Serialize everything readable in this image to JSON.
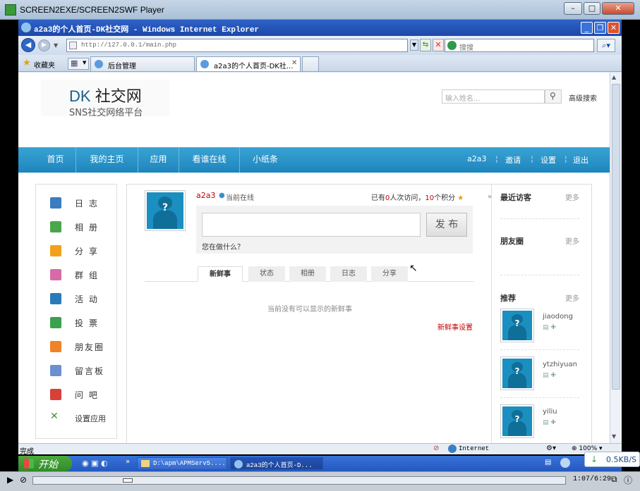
{
  "player": {
    "title": "SCREEN2EXE/SCREEN2SWF Player",
    "time": "1:07/6:29",
    "progress": 0.172
  },
  "browser": {
    "title": "a2a3的个人首页-DK社交网 - Windows Internet Explorer",
    "url": "http://127.0.0.1/main.php",
    "search_placeholder": "搜搜",
    "favorites": "收藏夹",
    "tabs": [
      "后台管理",
      "a2a3的个人首页-DK社..."
    ],
    "status": "完成",
    "zone": "Internet",
    "zoom": "100%"
  },
  "site": {
    "logo": "DK",
    "logo_cn": "社交网",
    "tagline": "SNS社交网络平台",
    "search_placeholder": "输入姓名...",
    "advanced_search": "高级搜索",
    "nav": [
      "首页",
      "我的主页",
      "应用",
      "看谁在线",
      "小纸条"
    ],
    "nav_right": [
      "a2a3",
      "邀请",
      "设置",
      "退出"
    ],
    "menu": [
      "日志",
      "相册",
      "分享",
      "群组",
      "活动",
      "投票",
      "朋友圈",
      "留言板",
      "问吧",
      "设置应用"
    ],
    "user": "a2a3",
    "online": "当前在线",
    "visits_prefix": "已有",
    "visits_count": "0",
    "visits_mid": "人次访问，",
    "points": "10",
    "points_suffix": "个积分",
    "publish": "发 布",
    "doing": "您在做什么？",
    "subtabs": [
      "新鲜事",
      "状态",
      "相册",
      "日志",
      "分享"
    ],
    "empty": "当前没有可以显示的新鲜事",
    "feed_settings": "新鲜事设置",
    "recent_visitors": "最近访客",
    "friend_circle": "朋友圈",
    "recommend": "推荐",
    "more": "更多",
    "recommended": [
      "jiaodong",
      "ytzhiyuan",
      "yiliu"
    ]
  },
  "taskbar": {
    "start": "开始",
    "tasks": [
      "D:\\apm\\APMServ5....",
      "a2a3的个人首页-D..."
    ],
    "net": "0.5KB/S"
  },
  "colors": {
    "accent": "#1d85bd",
    "red": "#c00000"
  }
}
